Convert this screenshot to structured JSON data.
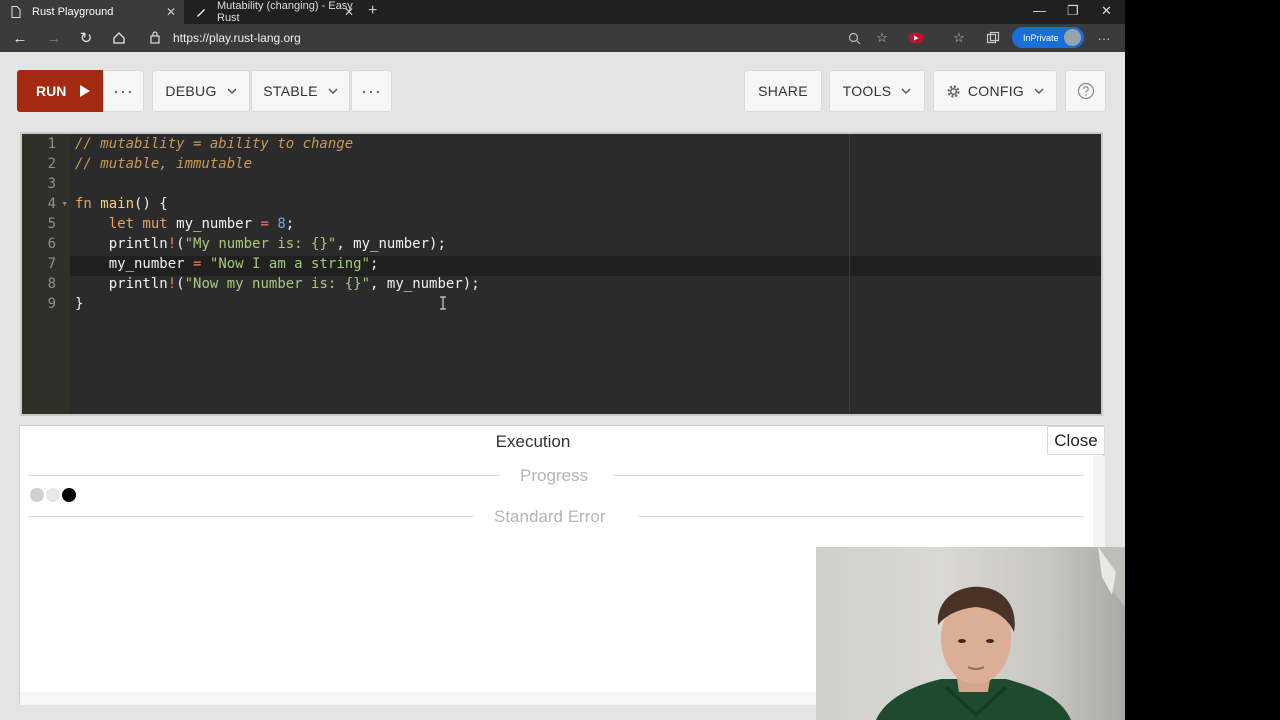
{
  "browser": {
    "tabs": [
      {
        "label": "Rust Playground",
        "active": true
      },
      {
        "label": "Mutability (changing) - Easy Rust",
        "active": false
      }
    ],
    "url": "https://play.rust-lang.org",
    "inprivate_label": "InPrivate"
  },
  "toolbar": {
    "run_label": "RUN",
    "mode_label": "DEBUG",
    "channel_label": "STABLE",
    "share_label": "SHARE",
    "tools_label": "TOOLS",
    "config_label": "CONFIG",
    "more_label": "···"
  },
  "editor": {
    "line_numbers": [
      "1",
      "2",
      "3",
      "4",
      "5",
      "6",
      "7",
      "8",
      "9"
    ],
    "lines": {
      "l1": "// mutability = ability to change",
      "l2": "// mutable, immutable",
      "l4_kw": "fn",
      "l4_name": "main",
      "l4_rest": "() {",
      "l5_kw": "let mut",
      "l5_var": "my_number",
      "l5_eq": "=",
      "l5_num": "8",
      "l5_end": ";",
      "l6_fn": "println",
      "l6_bang": "!",
      "l6_open": "(",
      "l6_str": "\"My number is: {}\"",
      "l6_rest": ", my_number);",
      "l7_var": "my_number",
      "l7_eq": "=",
      "l7_str": "\"Now I am a string\"",
      "l7_end": ";",
      "l8_fn": "println",
      "l8_bang": "!",
      "l8_open": "(",
      "l8_str": "\"Now my number is: {}\"",
      "l8_rest": ", my_number);",
      "l9": "}"
    }
  },
  "output": {
    "title": "Execution",
    "close_label": "Close",
    "progress_label": "Progress",
    "stderr_label": "Standard Error"
  },
  "colors": {
    "run_button": "#a42b11",
    "editor_bg": "#2b2b2b",
    "inprivate_badge": "#1a6fd6"
  }
}
